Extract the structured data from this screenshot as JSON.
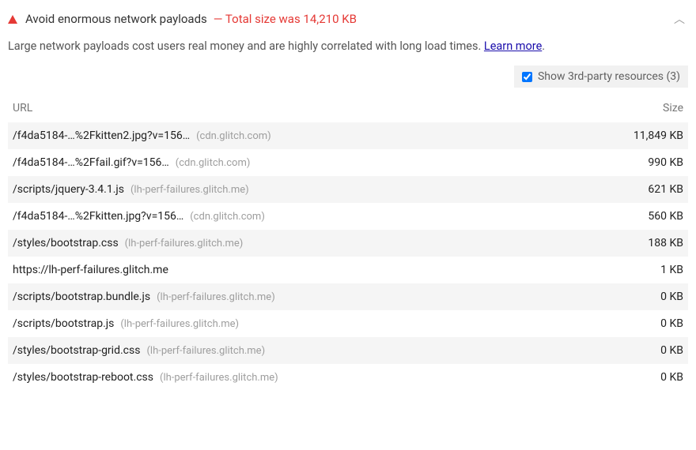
{
  "header": {
    "title": "Avoid enormous network payloads",
    "subtitle": "— Total size was 14,210 KB"
  },
  "description": {
    "text": "Large network payloads cost users real money and are highly correlated with long load times. ",
    "learn_more": "Learn more"
  },
  "controls": {
    "third_party_label": "Show 3rd-party resources (3)"
  },
  "table": {
    "columns": {
      "url": "URL",
      "size": "Size"
    },
    "rows": [
      {
        "path": "/f4da5184-…%2Fkitten2.jpg?v=156…",
        "host": "(cdn.glitch.com)",
        "size": "11,849 KB"
      },
      {
        "path": "/f4da5184-…%2Ffail.gif?v=156…",
        "host": "(cdn.glitch.com)",
        "size": "990 KB"
      },
      {
        "path": "/scripts/jquery-3.4.1.js",
        "host": "(lh-perf-failures.glitch.me)",
        "size": "621 KB"
      },
      {
        "path": "/f4da5184-…%2Fkitten.jpg?v=156…",
        "host": "(cdn.glitch.com)",
        "size": "560 KB"
      },
      {
        "path": "/styles/bootstrap.css",
        "host": "(lh-perf-failures.glitch.me)",
        "size": "188 KB"
      },
      {
        "path": "https://lh-perf-failures.glitch.me",
        "host": "",
        "size": "1 KB"
      },
      {
        "path": "/scripts/bootstrap.bundle.js",
        "host": "(lh-perf-failures.glitch.me)",
        "size": "0 KB"
      },
      {
        "path": "/scripts/bootstrap.js",
        "host": "(lh-perf-failures.glitch.me)",
        "size": "0 KB"
      },
      {
        "path": "/styles/bootstrap-grid.css",
        "host": "(lh-perf-failures.glitch.me)",
        "size": "0 KB"
      },
      {
        "path": "/styles/bootstrap-reboot.css",
        "host": "(lh-perf-failures.glitch.me)",
        "size": "0 KB"
      }
    ]
  }
}
